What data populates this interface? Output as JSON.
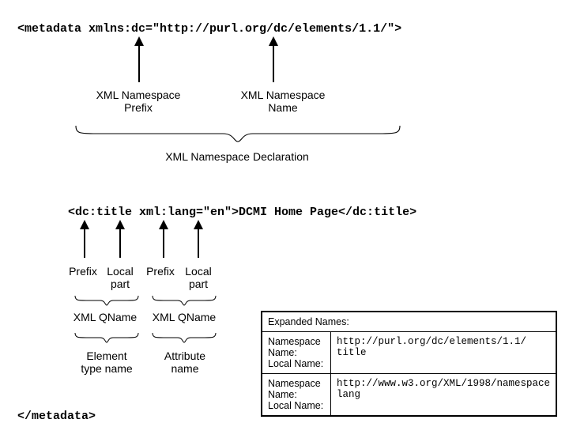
{
  "code": {
    "open": "<metadata xmlns:dc=\"http://purl.org/dc/elements/1.1/\">",
    "title": "<dc:title xml:lang=\"en\">DCMI Home Page</dc:title>",
    "close": "</metadata>"
  },
  "labels": {
    "ns_prefix": "XML Namespace\nPrefix",
    "ns_name": "XML Namespace\nName",
    "ns_decl": "XML Namespace Declaration",
    "prefix": "Prefix",
    "local_part": "Local\npart",
    "qname": "XML QName",
    "elem_type": "Element\ntype name",
    "attr_name": "Attribute\nname"
  },
  "table": {
    "heading": "Expanded Names:",
    "k_ns": "Namespace Name:",
    "k_local": "Local Name:",
    "r1_ns": "http://purl.org/dc/elements/1.1/",
    "r1_local": "title",
    "r2_ns": "http://www.w3.org/XML/1998/namespace",
    "r2_local": "lang"
  }
}
